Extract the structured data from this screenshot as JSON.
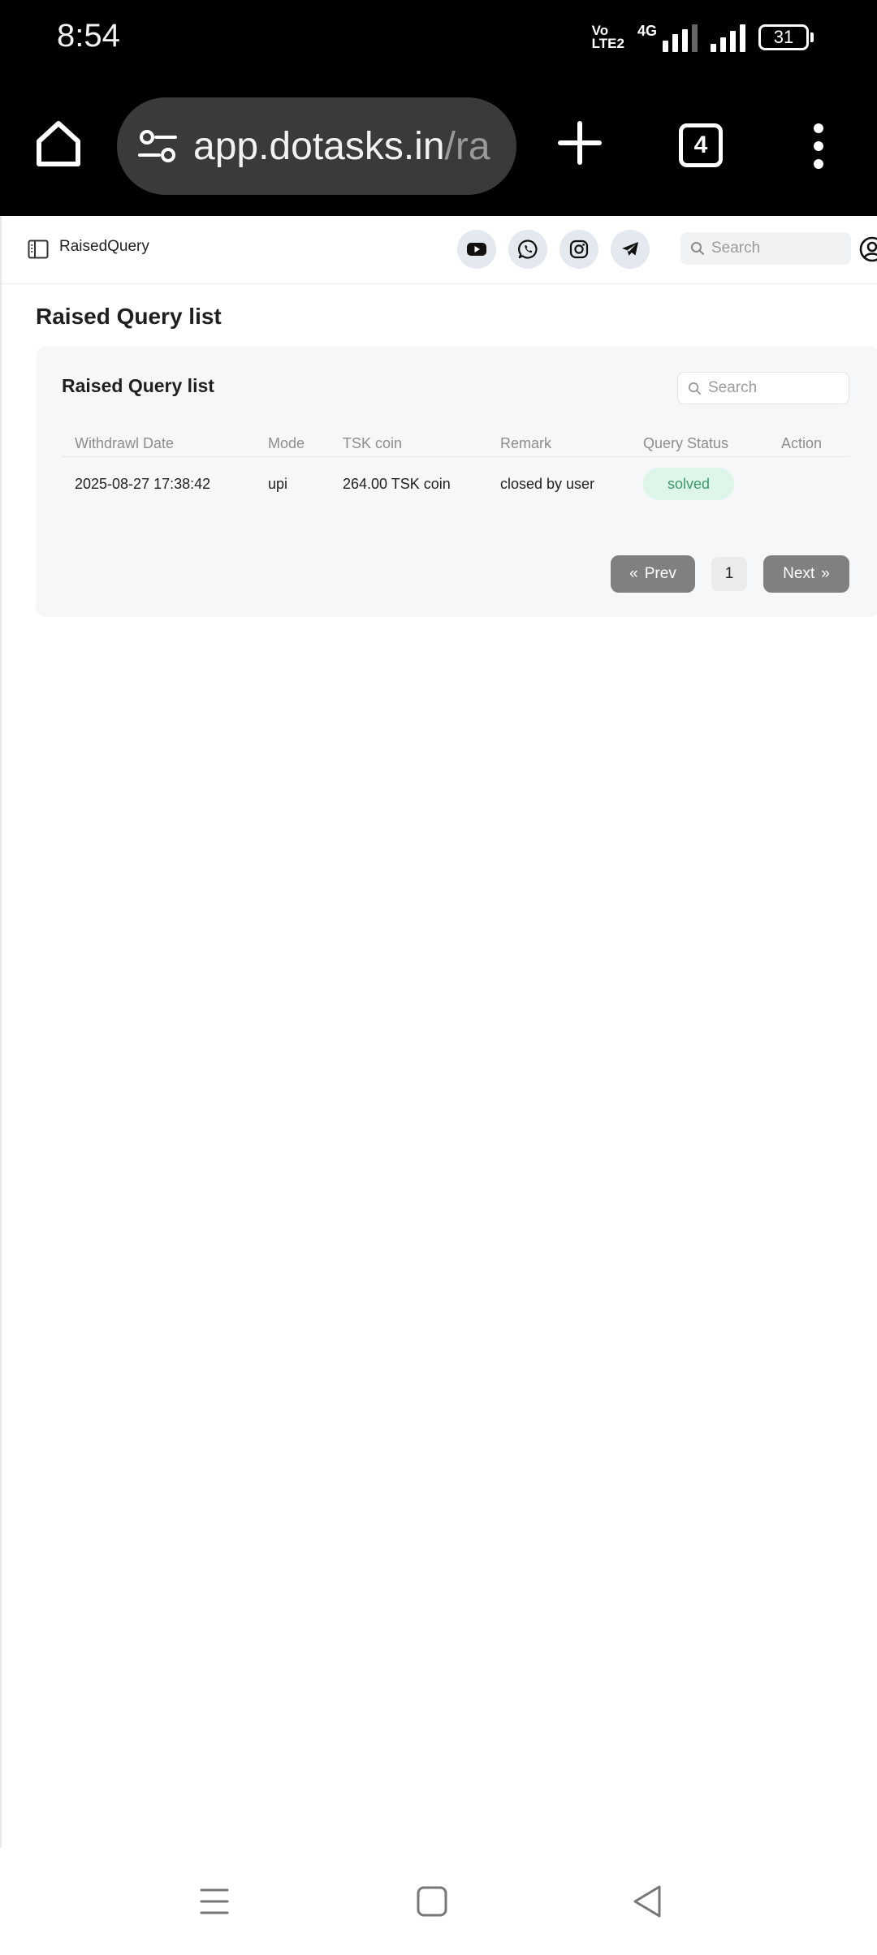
{
  "status_bar": {
    "time": "8:54",
    "volte_line1": "Vo",
    "volte_line2": "LTE2",
    "network_type": "4G",
    "battery": "31"
  },
  "browser": {
    "url_main": "app.dotasks.in",
    "url_dim": "/ra",
    "tab_count": "4"
  },
  "header": {
    "title": "RaisedQuery",
    "search_placeholder": "Search",
    "social_icons": [
      "youtube-icon",
      "whatsapp-icon",
      "instagram-icon",
      "telegram-icon"
    ]
  },
  "page": {
    "title": "Raised Query list"
  },
  "card": {
    "title": "Raised Query list",
    "search_placeholder": "Search",
    "columns": [
      "Withdrawl Date",
      "Mode",
      "TSK coin",
      "Remark",
      "Query Status",
      "Action"
    ],
    "rows": [
      {
        "date": "2025-08-27 17:38:42",
        "mode": "upi",
        "tsk_coin": "264.00 TSK coin",
        "remark": "closed by user",
        "status": "solved",
        "action": ""
      }
    ]
  },
  "pagination": {
    "prev_label": "Prev",
    "next_label": "Next",
    "current_page": "1"
  },
  "colors": {
    "status_solved_bg": "#def5e9",
    "status_solved_text": "#3b9a6a",
    "button_gray": "#808080"
  }
}
